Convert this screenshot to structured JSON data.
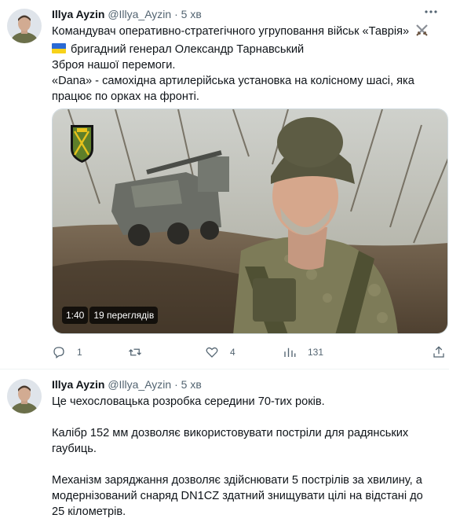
{
  "tweets": [
    {
      "author_name": "Illya Ayzin",
      "handle": "@Illya_Ayzin",
      "separator": "·",
      "time": "5 хв",
      "more_icon": "more-dots-icon",
      "lines": [
        "Командувач оперативно-стратегічного угруповання військ «Таврія»",
        "бригадний генерал Олександр Тарнавський",
        "Зброя нашої перемоги.",
        "«Dana» - самохідна артилерійська установка на колісному шасі, яка",
        "працює по орках на фронті."
      ],
      "video": {
        "duration": "1:40",
        "views": "19 переглядів"
      },
      "actions": {
        "reply_count": "1",
        "retweet_count": "",
        "like_count": "4",
        "views_count": "131"
      },
      "colors": {
        "flag_blue": "#2a6ad5",
        "flag_yellow": "#f7d21a"
      }
    },
    {
      "author_name": "Illya Ayzin",
      "handle": "@Illya_Ayzin",
      "separator": "·",
      "time": "5 хв",
      "lines": [
        "Це чехословацька розробка середини 70-тих років.",
        "",
        "Калібр 152 мм дозволяє використовувати постріли для радянських",
        "гаубиць.",
        "",
        "Механізм заряджання дозволяє здійснювати 5 пострілів за хвилину, а",
        "модернізований снаряд DN1CZ здатний знищувати цілі на відстані до",
        "25 кілометрів."
      ]
    }
  ],
  "theme": {
    "text": "#0f1419",
    "secondary": "#536471",
    "border": "#eff3f4"
  }
}
